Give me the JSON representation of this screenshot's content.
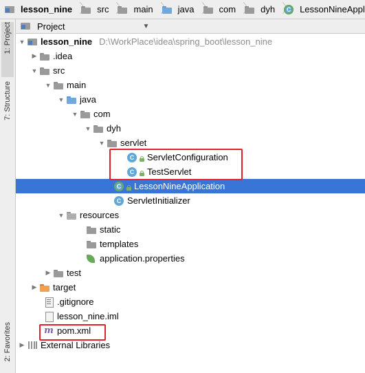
{
  "breadcrumb": [
    "lesson_nine",
    "src",
    "main",
    "java",
    "com",
    "dyh",
    "LessonNineApplicatio"
  ],
  "tool_strip": {
    "project_tab": "1: Project",
    "structure_tab": "7: Structure",
    "favorites_tab": "2: Favorites"
  },
  "panel": {
    "title": "Project",
    "caret": "▼"
  },
  "tree": {
    "root": {
      "label": "lesson_nine",
      "path": "D:\\WorkPlace\\idea\\spring_boot\\lesson_nine"
    },
    "idea": ".idea",
    "src": "src",
    "main": "main",
    "java": "java",
    "com": "com",
    "dyh": "dyh",
    "servlet": "servlet",
    "servlet_configuration": "ServletConfiguration",
    "test_servlet": "TestServlet",
    "lesson_nine_application": "LessonNineApplication",
    "servlet_initializer": "ServletInitializer",
    "resources": "resources",
    "static": "static",
    "templates": "templates",
    "application_properties": "application.properties",
    "test": "test",
    "target": "target",
    "gitignore": ".gitignore",
    "iml": "lesson_nine.iml",
    "pom": "pom.xml",
    "external_libraries": "External Libraries"
  },
  "icons": {
    "class_letter": "C",
    "maven_letter": "m"
  },
  "colors": {
    "selection": "#3875d7",
    "highlight_box": "#e1202a",
    "path_text": "#8c8c8c"
  }
}
